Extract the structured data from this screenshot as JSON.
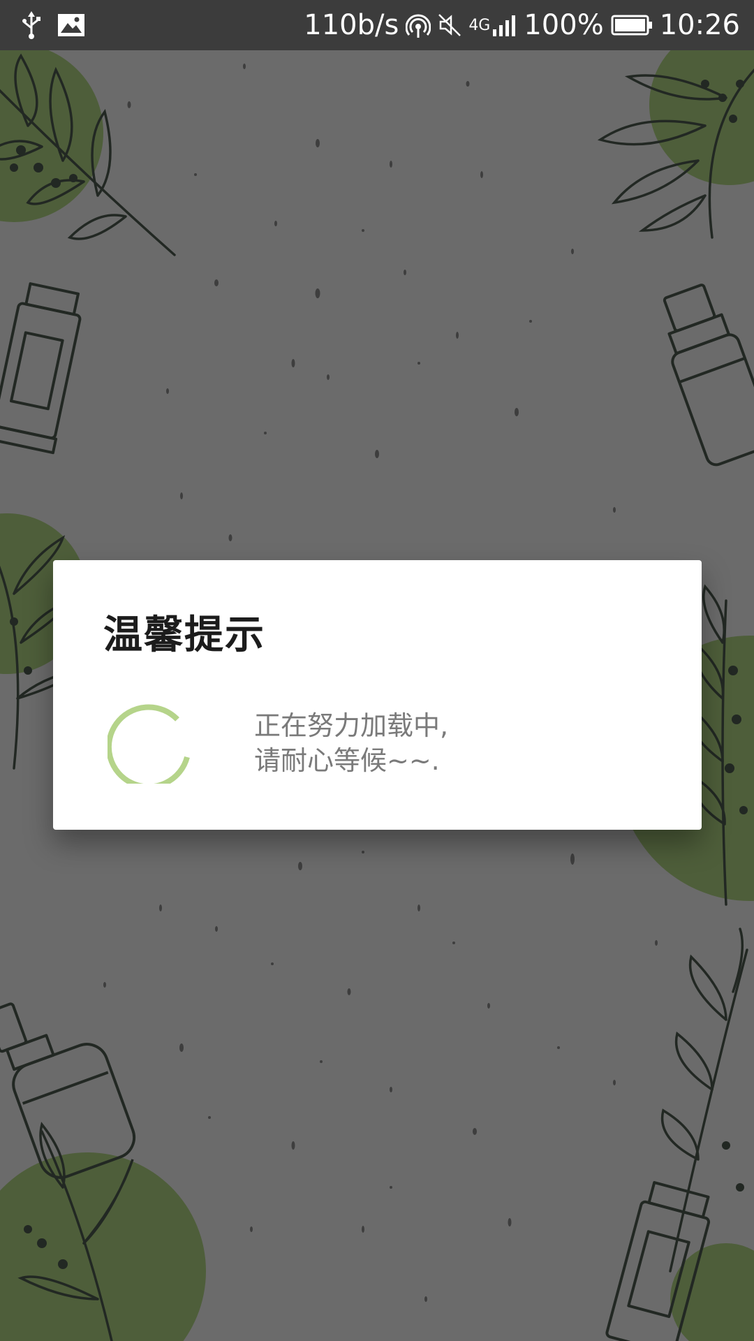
{
  "status_bar": {
    "speed": "110b/s",
    "network_type": "4G",
    "battery_percent": "100%",
    "time": "10:26",
    "left_icons": [
      "usb-icon",
      "image-icon"
    ],
    "right_icons": [
      "hotspot-icon",
      "mute-icon",
      "signal-icon",
      "battery-icon"
    ]
  },
  "dialog": {
    "title": "温馨提示",
    "message_line1": "正在努力加载中,",
    "message_line2": "请耐心等候~~.",
    "spinner_color": "#b5d48a"
  },
  "colors": {
    "background": "#6b6b6b",
    "leaf_green": "#4e5e3a",
    "status_bar": "#3c3c3c"
  }
}
